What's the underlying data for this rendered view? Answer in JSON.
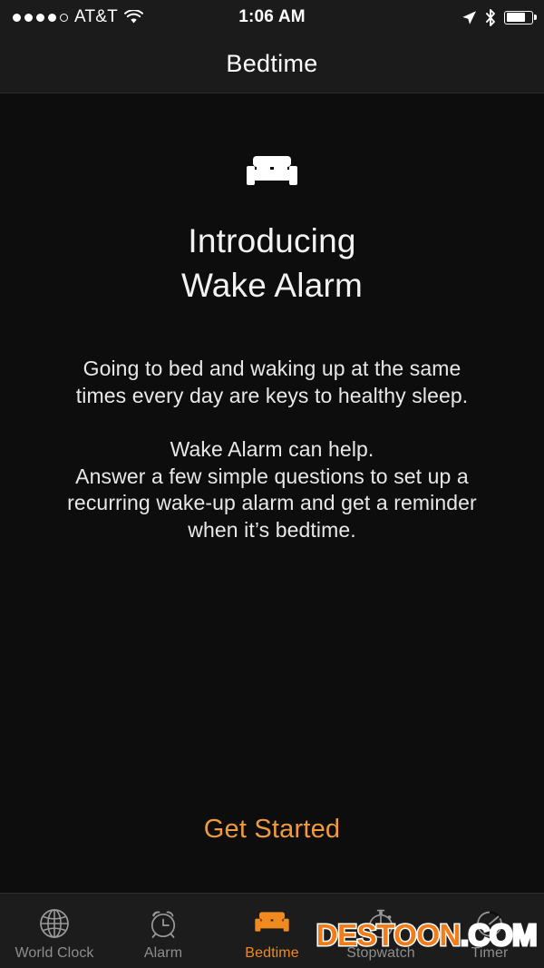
{
  "status_bar": {
    "signal_bars_filled": 4,
    "signal_bars_total": 5,
    "carrier": "AT&T",
    "wifi_icon": "wifi-icon",
    "time": "1:06 AM",
    "location_icon": "location-arrow-icon",
    "bluetooth_icon": "bluetooth-icon",
    "battery_icon": "battery-icon",
    "battery_level_percent": 75
  },
  "nav_bar": {
    "title": "Bedtime"
  },
  "hero": {
    "icon": "bed-icon",
    "headline_line1": "Introducing",
    "headline_line2": "Wake Alarm",
    "paragraph1": "Going to bed and waking up at the same times every day are keys to healthy sleep.",
    "paragraph2": "Wake Alarm can help.\nAnswer a few simple questions to set up a recurring wake-up alarm and get a reminder when it’s bedtime."
  },
  "cta": {
    "label": "Get Started",
    "color": "#f09a3e"
  },
  "tab_bar": {
    "active_color": "#f08a1e",
    "inactive_color": "#8e8e8e",
    "tabs": [
      {
        "label": "World Clock",
        "icon": "globe-icon",
        "active": false
      },
      {
        "label": "Alarm",
        "icon": "alarm-clock-icon",
        "active": false
      },
      {
        "label": "Bedtime",
        "icon": "bed-icon",
        "active": true
      },
      {
        "label": "Stopwatch",
        "icon": "stopwatch-icon",
        "active": false
      },
      {
        "label": "Timer",
        "icon": "timer-icon",
        "active": false
      }
    ]
  },
  "watermark": {
    "part1": "DESTOON",
    "part2": ".COM",
    "part1_color": "#f07d1a",
    "part2_color": "#ffffff"
  }
}
